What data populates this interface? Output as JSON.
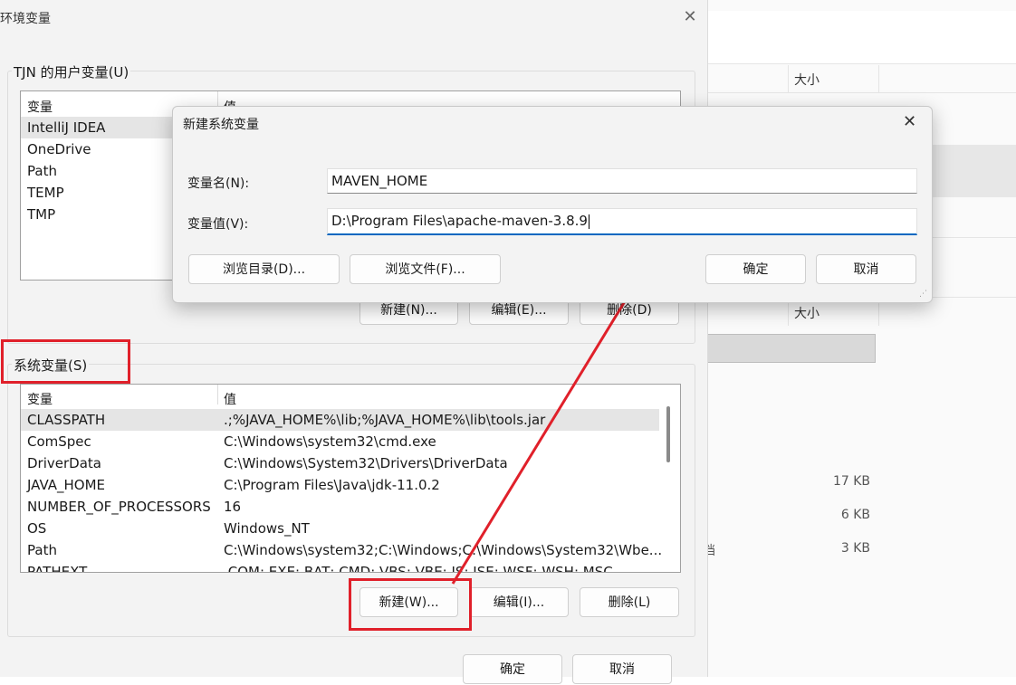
{
  "env_dialog": {
    "title": "环境变量",
    "close": "✕",
    "user_group": {
      "label": "TJN 的用户变量(U)",
      "col_var": "变量",
      "col_val": "值",
      "rows": [
        "IntelliJ IDEA",
        "OneDrive",
        "Path",
        "TEMP",
        "TMP"
      ],
      "buttons": {
        "new": "新建(N)...",
        "edit": "编辑(E)...",
        "delete": "删除(D)"
      }
    },
    "system_group": {
      "label": "系统变量(S)",
      "col_var": "变量",
      "col_val": "值",
      "rows": [
        {
          "name": "CLASSPATH",
          "value": ".;%JAVA_HOME%\\lib;%JAVA_HOME%\\lib\\tools.jar"
        },
        {
          "name": "ComSpec",
          "value": "C:\\Windows\\system32\\cmd.exe"
        },
        {
          "name": "DriverData",
          "value": "C:\\Windows\\System32\\Drivers\\DriverData"
        },
        {
          "name": "JAVA_HOME",
          "value": "C:\\Program Files\\Java\\jdk-11.0.2"
        },
        {
          "name": "NUMBER_OF_PROCESSORS",
          "value": "16"
        },
        {
          "name": "OS",
          "value": "Windows_NT"
        },
        {
          "name": "Path",
          "value": "C:\\Windows\\system32;C:\\Windows;C:\\Windows\\System32\\Wbe..."
        },
        {
          "name": "PATHEXT",
          "value": ".COM;.EXE;.BAT;.CMD;.VBS;.VBE;.JS;.JSE;.WSF;.WSH;.MSC"
        }
      ],
      "buttons": {
        "new": "新建(W)...",
        "edit": "编辑(I)...",
        "delete": "删除(L)"
      }
    },
    "ok": "确定",
    "cancel": "取消"
  },
  "new_var_dialog": {
    "title": "新建系统变量",
    "close": "✕",
    "name_label": "变量名(N):",
    "name_value": "MAVEN_HOME",
    "value_label": "变量值(V):",
    "value_value": "D:\\Program Files\\apache-maven-3.8.9",
    "browse_dir": "浏览目录(D)...",
    "browse_file": "浏览文件(F)...",
    "ok": "确定",
    "cancel": "取消"
  },
  "background_window": {
    "col_size": "大小",
    "sizes": [
      "17 KB",
      "6 KB",
      "3 KB"
    ],
    "partial_char": "档"
  },
  "colors": {
    "annotation_red": "#e0202a",
    "focus_blue": "#0067c0"
  }
}
